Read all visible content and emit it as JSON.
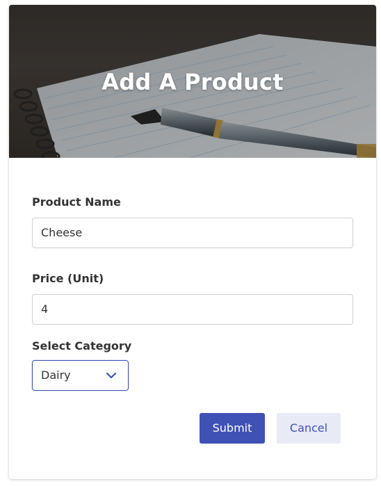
{
  "hero": {
    "title": "Add A Product"
  },
  "form": {
    "product_name": {
      "label": "Product Name",
      "value": "Cheese"
    },
    "price": {
      "label": "Price (Unit)",
      "value": "4"
    },
    "category": {
      "label": "Select Category",
      "selected": "Dairy",
      "icon": "chevron-down-icon"
    },
    "submit_label": "Submit",
    "cancel_label": "Cancel"
  },
  "colors": {
    "accent": "#3f51b5",
    "secondary_button_bg": "#e8eaf6"
  }
}
